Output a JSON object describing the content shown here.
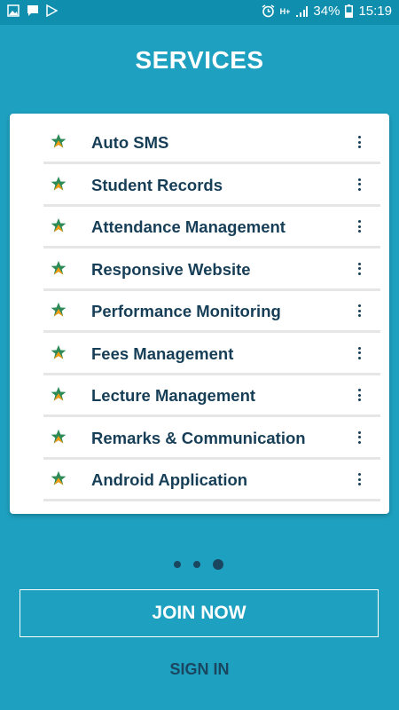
{
  "status_bar": {
    "battery": "34%",
    "time": "15:19",
    "network": "H+",
    "icons": [
      "gallery-icon",
      "message-icon",
      "play-store-icon",
      "alarm-icon",
      "signal-icon",
      "battery-icon"
    ]
  },
  "header": {
    "title": "SERVICES"
  },
  "services": {
    "items": [
      {
        "label": "Auto SMS",
        "icon": "star-icon"
      },
      {
        "label": "Student Records",
        "icon": "star-icon"
      },
      {
        "label": "Attendance Management",
        "icon": "star-icon"
      },
      {
        "label": "Responsive Website",
        "icon": "star-icon"
      },
      {
        "label": "Performance Monitoring",
        "icon": "star-icon"
      },
      {
        "label": "Fees Management",
        "icon": "star-icon"
      },
      {
        "label": "Lecture Management",
        "icon": "star-icon"
      },
      {
        "label": "Remarks & Communication",
        "icon": "star-icon"
      },
      {
        "label": "Android Application",
        "icon": "star-icon"
      }
    ]
  },
  "pager": {
    "current_page": 3,
    "total_pages": 3
  },
  "actions": {
    "join_label": "JOIN NOW",
    "signin_label": "SIGN IN"
  },
  "colors": {
    "background": "#1ea1c0",
    "status_bar": "#0f8eae",
    "text_dark": "#163e57",
    "star_green": "#2e8b57",
    "star_orange": "#f39c12"
  }
}
